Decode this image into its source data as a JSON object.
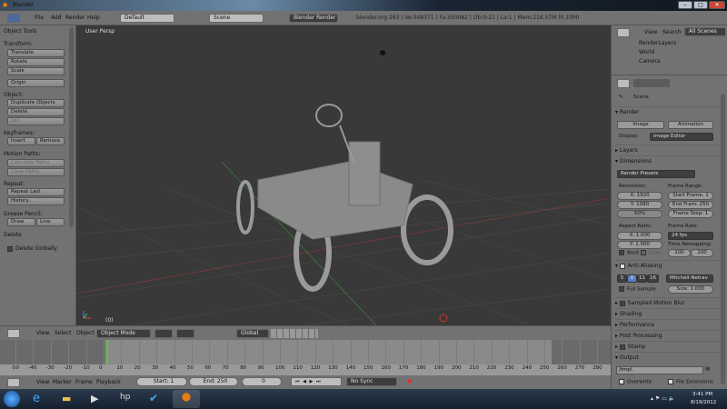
{
  "window": {
    "title": "Blender",
    "min": "–",
    "max": "□",
    "close": "✕"
  },
  "info": {
    "menus": [
      "File",
      "Add",
      "Render",
      "Help"
    ],
    "layout": "Default",
    "scene": "Scene",
    "engine": "Blender Render",
    "stats": "blender.org 263 | Ve:348371 | Fa:350082 | Ob:0-21 | La:1 | Mem:216.57M (0.10M)"
  },
  "tools": {
    "title": "Object Tools",
    "transform_label": "Transform:",
    "translate": "Translate",
    "rotate": "Rotate",
    "scale": "Scale",
    "origin": "Origin",
    "object_label": "Object:",
    "duplicate": "Duplicate Objects",
    "delete": "Delete",
    "join": "Join",
    "keyframes_label": "Keyframes:",
    "insert": "Insert",
    "remove": "Remove",
    "motion_label": "Motion Paths:",
    "calc_paths": "Calculate Paths",
    "clear_paths": "Clear Paths",
    "repeat_label": "Repeat:",
    "repeat_last": "Repeat Last",
    "history": "History...",
    "grease_label": "Grease Pencil:",
    "draw": "Draw",
    "line": "Line",
    "delete_panel": "Delete",
    "delete_globally": "Delete Globally"
  },
  "viewport": {
    "label": "User Persp",
    "frame": "(0)"
  },
  "outliner": {
    "view": "View",
    "search": "Search",
    "filter": "All Scenes",
    "items": [
      "RenderLayers",
      "World",
      "Camera"
    ]
  },
  "props": {
    "scene": "Scene",
    "render": "Render",
    "image": "Image",
    "animation": "Animation",
    "display_label": "Display:",
    "display": "Image Editor",
    "layers": "Layers",
    "dimensions": "Dimensions",
    "presets": "Render Presets",
    "resolution": "Resolution:",
    "res_x": "X: 1920",
    "res_y": "Y: 1080",
    "res_pct": "50%",
    "frame_range": "Frame Range:",
    "start": "Start Frame: 1",
    "end": "End Fram: 250",
    "step": "Frame Step: 1",
    "aspect": "Aspect Ratio:",
    "asp_x": "X: 1.000",
    "asp_y": "Y: 1.000",
    "frame_rate": "Frame Rate:",
    "fps": "24 fps",
    "remap": "Time Remapping:",
    "remap_old": "100",
    "remap_new": "100",
    "bord": "Bord",
    "crop": "Crop",
    "aa": "Anti-Aliasing",
    "aa_samples": [
      "5",
      "8",
      "11",
      "16"
    ],
    "aa_selected": "8",
    "filter": "Mitchell-Netrav",
    "full_sample": "Full Sample",
    "size": "Size: 1.000",
    "motion_blur": "Sampled Motion Blur",
    "shading": "Shading",
    "performance": "Performance",
    "post": "Post Processing",
    "stamp": "Stamp",
    "output": "Output",
    "path": "/tmp\\",
    "overwrite": "Overwrite",
    "file_ext": "File Extensions"
  },
  "v3dheader": {
    "menus": [
      "View",
      "Select",
      "Object"
    ],
    "mode": "Object Mode",
    "orientation": "Global"
  },
  "timeline": {
    "ticks": [
      "-50",
      "-40",
      "-30",
      "-20",
      "-10",
      "0",
      "10",
      "20",
      "30",
      "40",
      "50",
      "60",
      "70",
      "80",
      "90",
      "100",
      "110",
      "120",
      "130",
      "140",
      "150",
      "160",
      "170",
      "180",
      "190",
      "200",
      "210",
      "220",
      "230",
      "240",
      "250",
      "260",
      "270",
      "280"
    ],
    "menus": [
      "View",
      "Marker",
      "Frame",
      "Playback"
    ],
    "start": "Start: 1",
    "end": "End: 250",
    "current": "0",
    "sync": "No Sync"
  },
  "taskbar": {
    "time": "3:41 PM",
    "date": "8/19/2012"
  },
  "colors": {
    "accent": "#5680c2",
    "viewport_bg": "#393939",
    "panel": "#727272",
    "current_frame": "#60c040"
  }
}
